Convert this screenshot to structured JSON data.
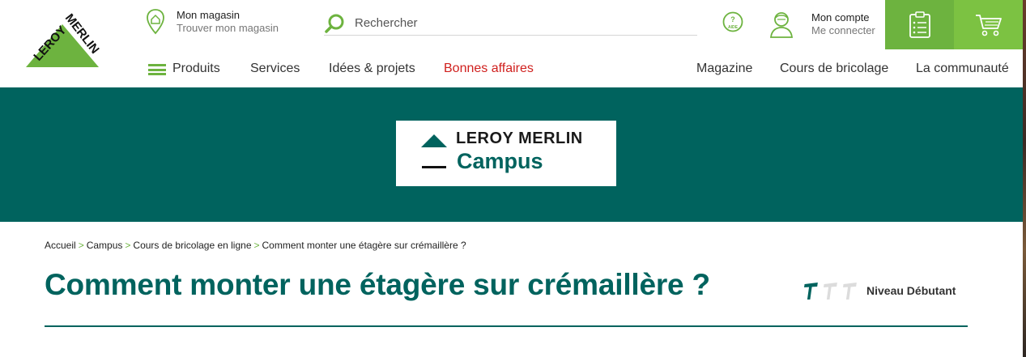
{
  "header": {
    "logo_text": "LEROY MERLIN",
    "store": {
      "title": "Mon magasin",
      "subtitle": "Trouver mon magasin"
    },
    "search": {
      "placeholder": "Rechercher"
    },
    "help_label": "AIDE",
    "account": {
      "title": "Mon compte",
      "subtitle": "Me connecter"
    },
    "colors": {
      "green": "#6db33f",
      "green_light": "#7cc242",
      "teal": "#00635e",
      "red": "#d0201e"
    }
  },
  "nav": {
    "left": [
      {
        "label": "Produits"
      },
      {
        "label": "Services"
      },
      {
        "label": "Idées & projets"
      },
      {
        "label": "Bonnes affaires"
      }
    ],
    "right": [
      {
        "label": "Magazine"
      },
      {
        "label": "Cours de bricolage"
      },
      {
        "label": "La communauté"
      }
    ]
  },
  "banner": {
    "brand": "LEROY MERLIN",
    "sub": "Campus"
  },
  "breadcrumb": [
    {
      "label": "Accueil"
    },
    {
      "label": "Campus"
    },
    {
      "label": "Cours de bricolage en ligne"
    },
    {
      "label": "Comment monter une étagère sur crémaillère ?"
    }
  ],
  "breadcrumb_separator": ">",
  "page": {
    "title": "Comment monter une étagère sur crémaillère ?",
    "level_label": "Niveau Débutant",
    "level_value": 1,
    "level_max": 3
  }
}
